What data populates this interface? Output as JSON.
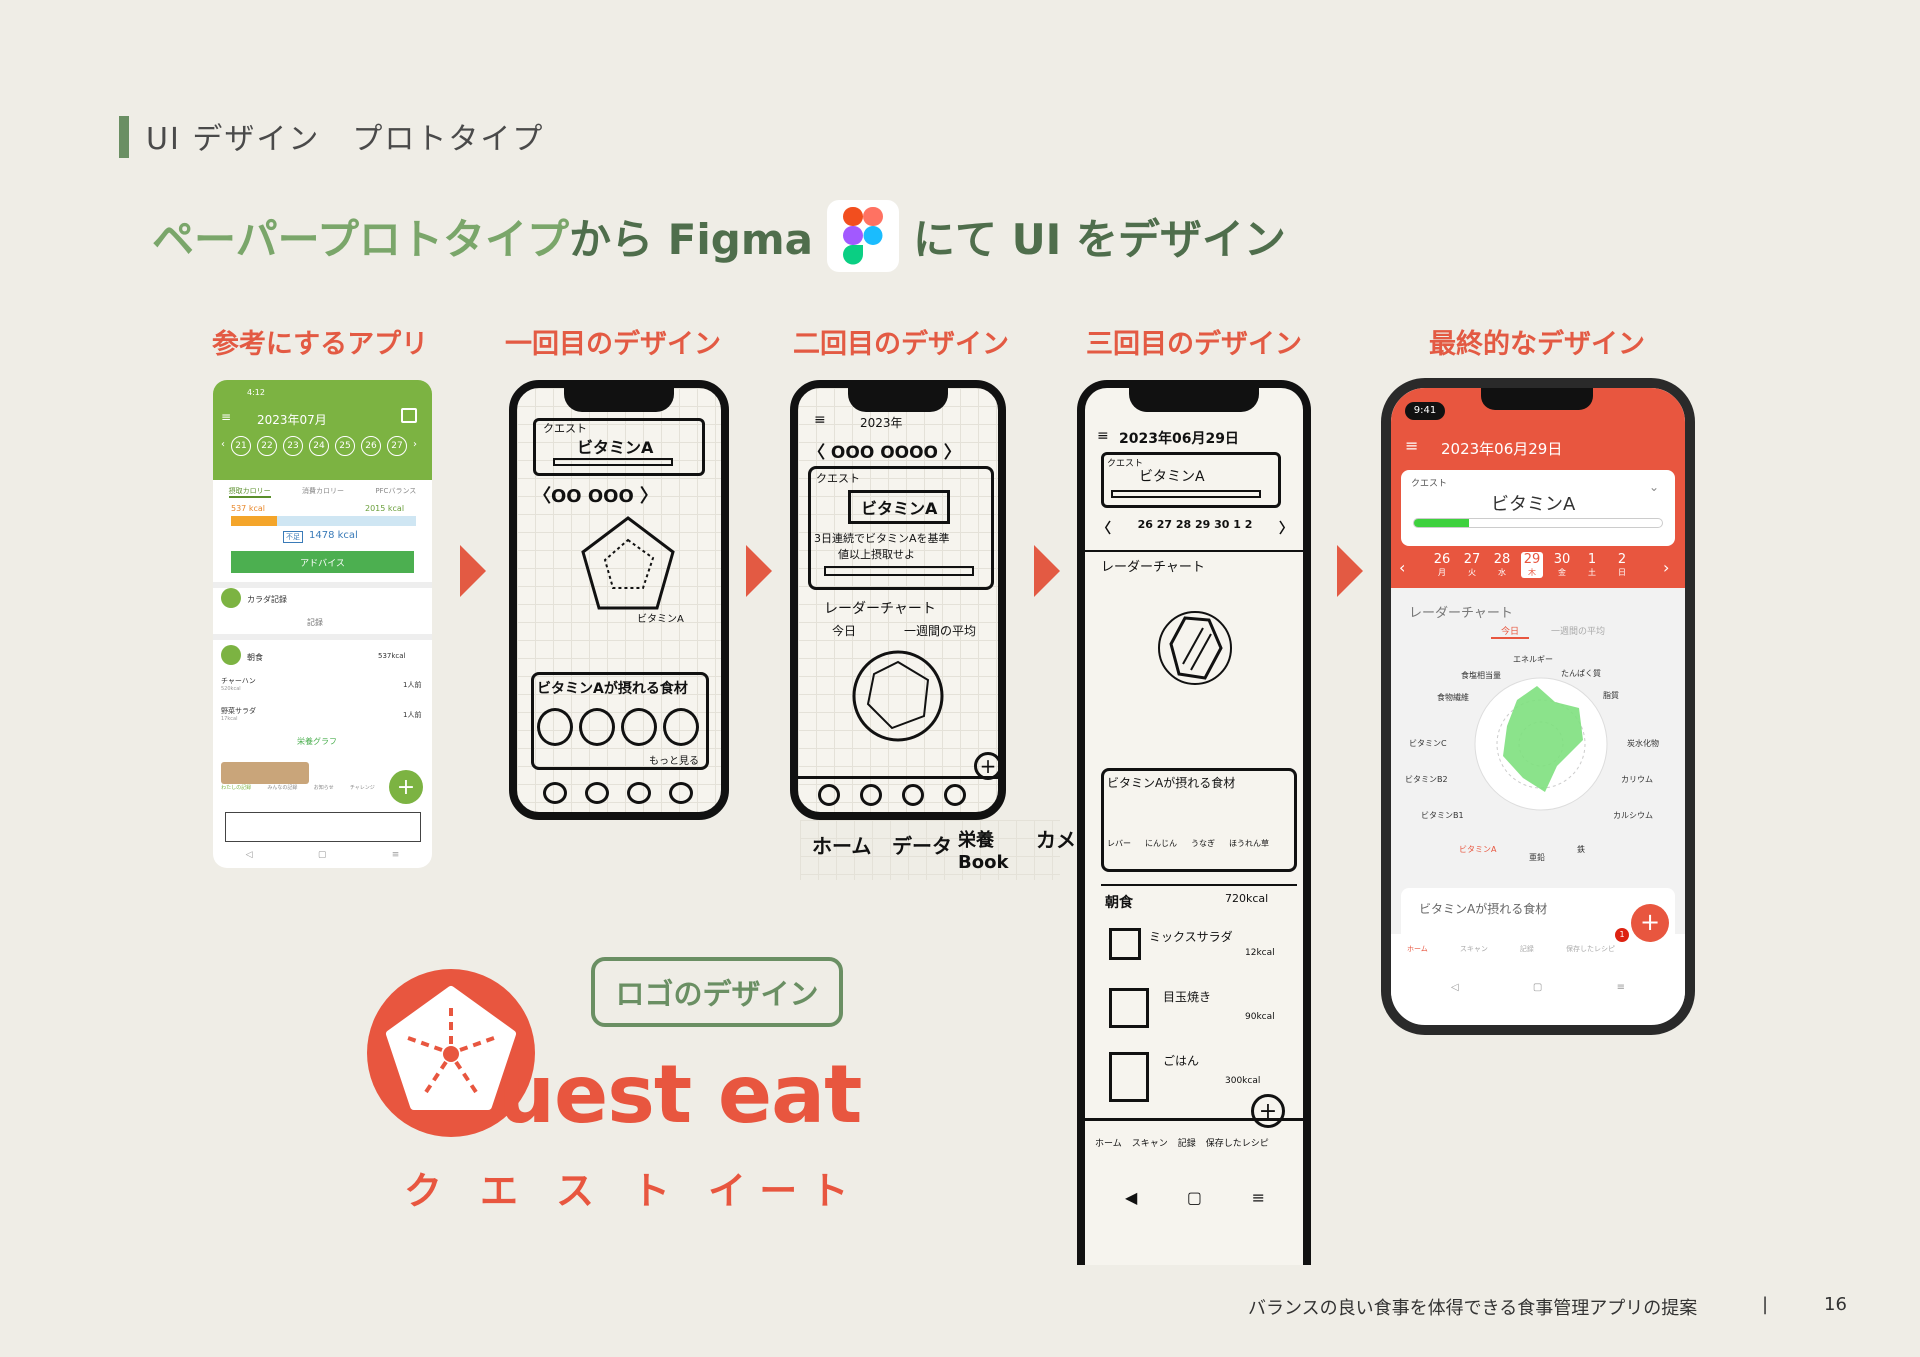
{
  "header": {
    "section": "UI デザイン　プロトタイプ"
  },
  "headline": {
    "part1": "ペーパープロトタイプ",
    "part2": "から Figma",
    "part3": "にて UI をデザイン"
  },
  "columns": [
    "参考にするアプリ",
    "一回目のデザイン",
    "二回目のデザイン",
    "三回目のデザイン",
    "最終的なデザイン"
  ],
  "ref_app": {
    "time": "4:12",
    "month": "2023年07月",
    "days": [
      "21",
      "22",
      "23",
      "24",
      "25",
      "26",
      "27"
    ],
    "tabs": [
      "摂取カロリー",
      "消費カロリー",
      "PFCバランス"
    ],
    "intake": "537 kcal",
    "target": "2015 kcal",
    "remain_label": "不足",
    "remain": "1478 kcal",
    "advice": "アドバイス",
    "body_record": "カラダ記録",
    "record": "記録",
    "meal": "朝食",
    "meal_kcal": "537kcal",
    "items": [
      {
        "name": "チャーハン",
        "kcal": "520kcal",
        "qty": "1人前"
      },
      {
        "name": "野菜サラダ",
        "kcal": "17kcal",
        "qty": "1人前"
      }
    ],
    "graph": "栄養グラフ",
    "nav": [
      "わたしの記録",
      "みんなの記録",
      "お知らせ",
      "チャレンジ"
    ]
  },
  "sketch1": {
    "quest": "クエスト",
    "vitamin": "ビタミンA",
    "row": "〈OO OOO 〉",
    "radar_label": "ビタミンA",
    "foods": "ビタミンAが摂れる食材",
    "more": "もっと見る"
  },
  "sketch2": {
    "year": "2023年",
    "row": "〈 OOO OOOO 〉",
    "quest": "クエスト",
    "vitamin": "ビタミンA",
    "mission1": "3日連続でビタミンAを基準",
    "mission2": "値以上摂取せよ",
    "radar": "レーダーチャート",
    "today": "今日",
    "week": "一週間の平均",
    "labels": [
      "ホーム",
      "データ",
      "栄養Book",
      "カメラ"
    ]
  },
  "sketch3": {
    "date": "2023年06月29日",
    "quest": "クエスト",
    "vitamin": "ビタミンA",
    "radar": "レーダーチャート",
    "foods": "ビタミンAが摂れる食材",
    "food_items": [
      "レバー",
      "にんじん",
      "うなぎ",
      "ほうれん草"
    ],
    "meal": "朝食",
    "meal_kcal": "720kcal",
    "dishes": [
      {
        "name": "ミックスサラダ",
        "kcal": "12kcal"
      },
      {
        "name": "目玉焼き",
        "kcal": "90kcal"
      },
      {
        "name": "ごはん",
        "kcal": "300kcal"
      }
    ],
    "nav": [
      "ホーム",
      "スキャン",
      "記録",
      "保存したレシピ"
    ]
  },
  "final": {
    "time": "9:41",
    "date": "2023年06月29日",
    "quest_label": "クエスト",
    "vitamin": "ビタミンA",
    "days": [
      {
        "n": "26",
        "w": "月"
      },
      {
        "n": "27",
        "w": "火"
      },
      {
        "n": "28",
        "w": "水"
      },
      {
        "n": "29",
        "w": "木"
      },
      {
        "n": "30",
        "w": "金"
      },
      {
        "n": "1",
        "w": "土"
      },
      {
        "n": "2",
        "w": "日"
      }
    ],
    "radar_title": "レーダーチャート",
    "tab_today": "今日",
    "tab_week": "一週間の平均",
    "axes": [
      "エネルギー",
      "たんぱく質",
      "脂質",
      "炭水化物",
      "カリウム",
      "カルシウム",
      "鉄",
      "亜鉛",
      "ビタミンA",
      "ビタミンB1",
      "ビタミンB2",
      "ビタミンC",
      "食物繊維",
      "食塩相当量"
    ],
    "foods_title": "ビタミンAが摂れる食材",
    "nav": [
      "ホーム",
      "スキャン",
      "記録",
      "保存したレシピ"
    ],
    "badge": "1"
  },
  "logo": {
    "pill": "ロゴのデザイン",
    "name": "uest eat",
    "kana": "ク　エ　ス　ト　イ ー ト"
  },
  "footer": {
    "caption": "バランスの良い食事を体得できる食事管理アプリの提案",
    "divider": "|",
    "page": "16"
  },
  "colors": {
    "red": "#e35a43",
    "green": "#6a8f63",
    "bg": "#efede6"
  }
}
